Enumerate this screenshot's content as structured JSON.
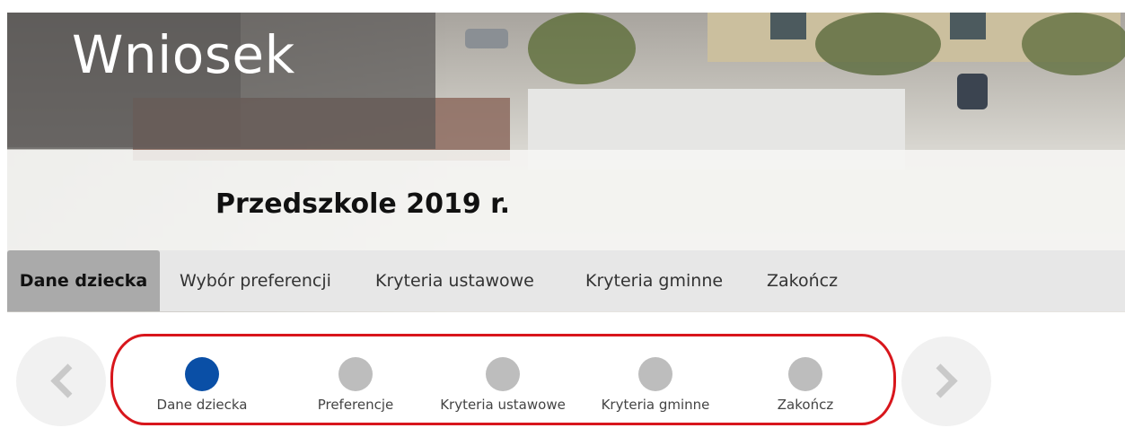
{
  "header": {
    "title": "Wniosek",
    "subtitle": "Przedszkole 2019 r."
  },
  "tabs": [
    {
      "label": "Dane dziecka",
      "active": true
    },
    {
      "label": "Wybór preferencji",
      "active": false
    },
    {
      "label": "Kryteria ustawowe",
      "active": false
    },
    {
      "label": "Kryteria gminne",
      "active": false
    },
    {
      "label": "Zakończ",
      "active": false
    }
  ],
  "stepper": {
    "steps": [
      {
        "label": "Dane dziecka",
        "active": true
      },
      {
        "label": "Preferencje",
        "active": false
      },
      {
        "label": "Kryteria ustawowe",
        "active": false
      },
      {
        "label": "Kryteria gminne",
        "active": false
      },
      {
        "label": "Zakończ",
        "active": false
      }
    ],
    "prev_icon": "chevron-left-icon",
    "next_icon": "chevron-right-icon"
  },
  "colors": {
    "active_step": "#0a4fa6",
    "inactive_step": "#bdbdbd",
    "highlight_border": "#d8161c",
    "active_tab_bg": "#aaaaaa",
    "tabbar_bg": "#e7e7e7"
  }
}
